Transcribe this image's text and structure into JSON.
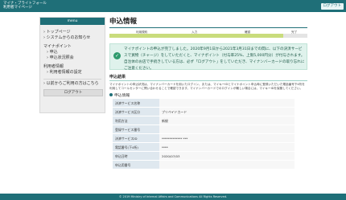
{
  "header": {
    "logo_line1": "マイナ・ブライトフォール",
    "logo_line2": "利用者マイページ",
    "button_label": "ログアウト"
  },
  "sidebar": {
    "title": "menu",
    "items": [
      {
        "label": "トップページ",
        "sub": false
      },
      {
        "label": "システムからのお知らせ",
        "sub": false
      },
      {
        "label": "マイナポイント",
        "sub": false
      },
      {
        "label": "申込",
        "sub": true
      },
      {
        "label": "申込状況照会",
        "sub": true
      },
      {
        "label": "利用者情報",
        "sub": false
      },
      {
        "label": "利用者情報の設定",
        "sub": true
      },
      {
        "label": "以前からご利用の方はこちら",
        "sub": false
      }
    ],
    "logout_label": "ログアウト"
  },
  "main": {
    "title": "申込情報",
    "steps": [
      "利用規約",
      "入力",
      "確認",
      "完了"
    ],
    "progress_fraction": 0.88,
    "notice": "マイナポイントの申込が完了しました。2020年9月1日から2021年3月31日までの間に、以下の決済サービスで買物（チャージ）をしていただくと、マイナポイント（付与率25%、上限5,000円分）が付与されます。自治体のお店で手続きしている方は、必ず「ログアウト」をしていただき、マイナンバーカードの取り忘れにご注意ください。",
    "section_title": "申込結果",
    "description": "マイナポイントの申込状況は、マイナンバーカードを用いたログイン、または、マイキーIDとマイナポイント申込時に登録いただいた電話番号下4桁を利用してコールセンターに問い合わせることで確認できます。マイナンバーカードでのログインが難しい場合には、マイキーIDを保管してください。",
    "info_title": "申込情報",
    "rows": [
      {
        "key": "決済サービス名称",
        "value": ""
      },
      {
        "key": "決済サービス区分",
        "value": "プリペイドカード"
      },
      {
        "key": "利用方法",
        "value": "新規"
      },
      {
        "key": "登録サービス番号",
        "value": ""
      },
      {
        "key": "決済サービスID",
        "value": "************* ***"
      },
      {
        "key": "電話番号(下4桁)",
        "value": "****"
      },
      {
        "key": "申込日時",
        "value": "2020/07/03"
      },
      {
        "key": "申込用番号",
        "value": ""
      }
    ]
  },
  "footer": {
    "copyright": "© 2019 Ministry of Internal Affairs and Communications All Rights Reserved."
  }
}
